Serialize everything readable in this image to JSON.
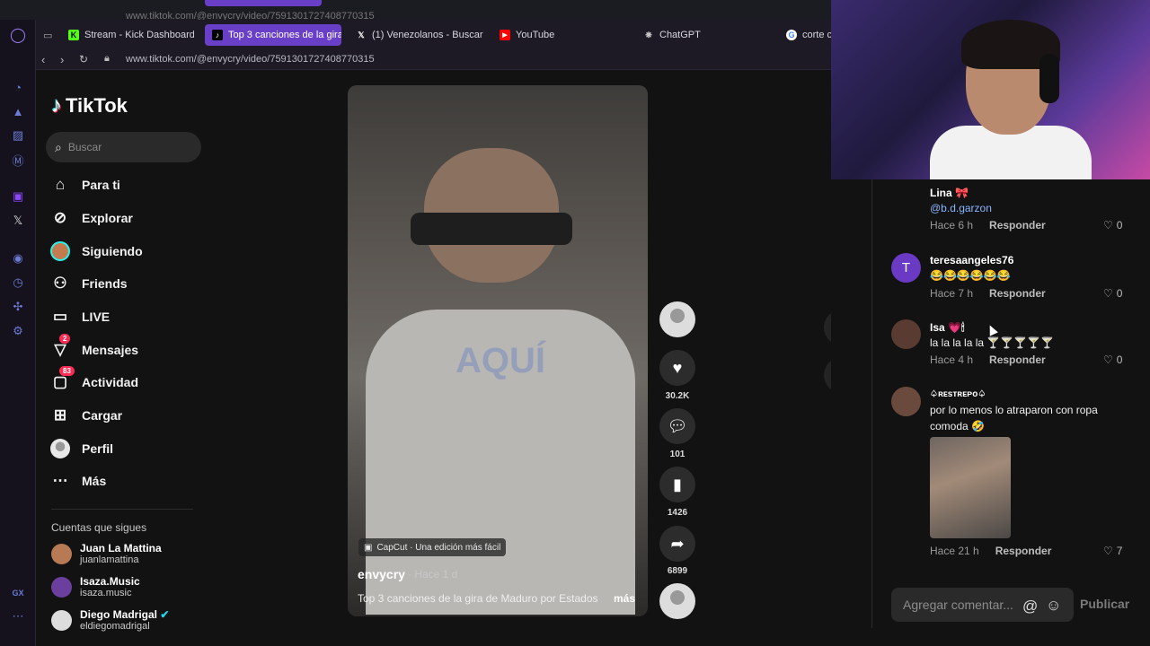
{
  "browser": {
    "ghost_url": "www.tiktok.com/@envycry/video/7591301727408770315",
    "tabs": [
      {
        "label": "Stream - Kick Dashboard",
        "icon": "kick-icon",
        "color": "#53fc18"
      },
      {
        "label": "Top 3 canciones de la gira",
        "icon": "tiktok-icon",
        "color": "#ffffff",
        "active": true
      },
      {
        "label": "(1) Venezolanos - Buscar",
        "icon": "x-icon",
        "color": "#ffffff"
      },
      {
        "label": "YouTube",
        "icon": "youtube-icon",
        "color": "#ff0000"
      },
      {
        "label": "ChatGPT",
        "icon": "chatgpt-icon",
        "color": "#cccccc"
      },
      {
        "label": "corte c",
        "icon": "google-icon",
        "color": "#4285f4"
      }
    ],
    "url": "www.tiktok.com/@envycry/video/7591301727408770315",
    "sidebar_bottom_label": "GX",
    "accent": "#6a3fc7"
  },
  "tiktok": {
    "logo_text": "TikTok",
    "search_placeholder": "Buscar",
    "nav": [
      {
        "label": "Para ti",
        "icon": "home-icon"
      },
      {
        "label": "Explorar",
        "icon": "compass-icon"
      },
      {
        "label": "Siguiendo",
        "icon": "following-avatar-icon"
      },
      {
        "label": "Friends",
        "icon": "friends-icon"
      },
      {
        "label": "LIVE",
        "icon": "live-icon"
      },
      {
        "label": "Mensajes",
        "icon": "messages-icon",
        "badge": "2"
      },
      {
        "label": "Actividad",
        "icon": "activity-icon",
        "badge": "83"
      },
      {
        "label": "Cargar",
        "icon": "upload-icon"
      },
      {
        "label": "Perfil",
        "icon": "profile-avatar-icon"
      },
      {
        "label": "Más",
        "icon": "more-icon"
      }
    ],
    "following_title": "Cuentas que sigues",
    "following": [
      {
        "name": "Juan La Mattina",
        "handle": "juanlamattina"
      },
      {
        "name": "Isaza.Music",
        "handle": "isaza.music"
      },
      {
        "name": "Diego Madrigal",
        "handle": "eldiegomadrigal",
        "verified": true
      }
    ]
  },
  "video": {
    "watermark": "AQUÍ",
    "capcut_tag": "CapCut · Una edición más fácil",
    "author": "envycry",
    "time": "· Hace 1 d",
    "caption": "Top 3 canciones de la gira de Maduro por Estados",
    "more": "más",
    "likes": "30.2K",
    "comments": "101",
    "saves": "1426",
    "shares": "6899"
  },
  "comments": [
    {
      "user": "Lina 🎀",
      "text": "@b.d.garzon",
      "time": "Hace 6 h",
      "reply": "Responder",
      "likes": "0",
      "text_color": "#8ab4ff"
    },
    {
      "user": "teresaangeles76",
      "text": "😂😂😂😂😂😂",
      "time": "Hace 7 h",
      "reply": "Responder",
      "likes": "0",
      "initial": "T"
    },
    {
      "user": "Isa 💗🕯",
      "text": "la la la la la 🍸🍸🍸🍸🍸",
      "time": "Hace 4 h",
      "reply": "Responder",
      "likes": "0"
    },
    {
      "user": "♤ʀᴇsᴛʀᴇᴘᴏ♤",
      "text": "por lo menos lo atraparon con ropa comoda 🤣",
      "time": "Hace 21 h",
      "reply": "Responder",
      "likes": "7"
    }
  ],
  "comment_input": {
    "placeholder": "Agregar comentar...",
    "publish": "Publicar"
  }
}
